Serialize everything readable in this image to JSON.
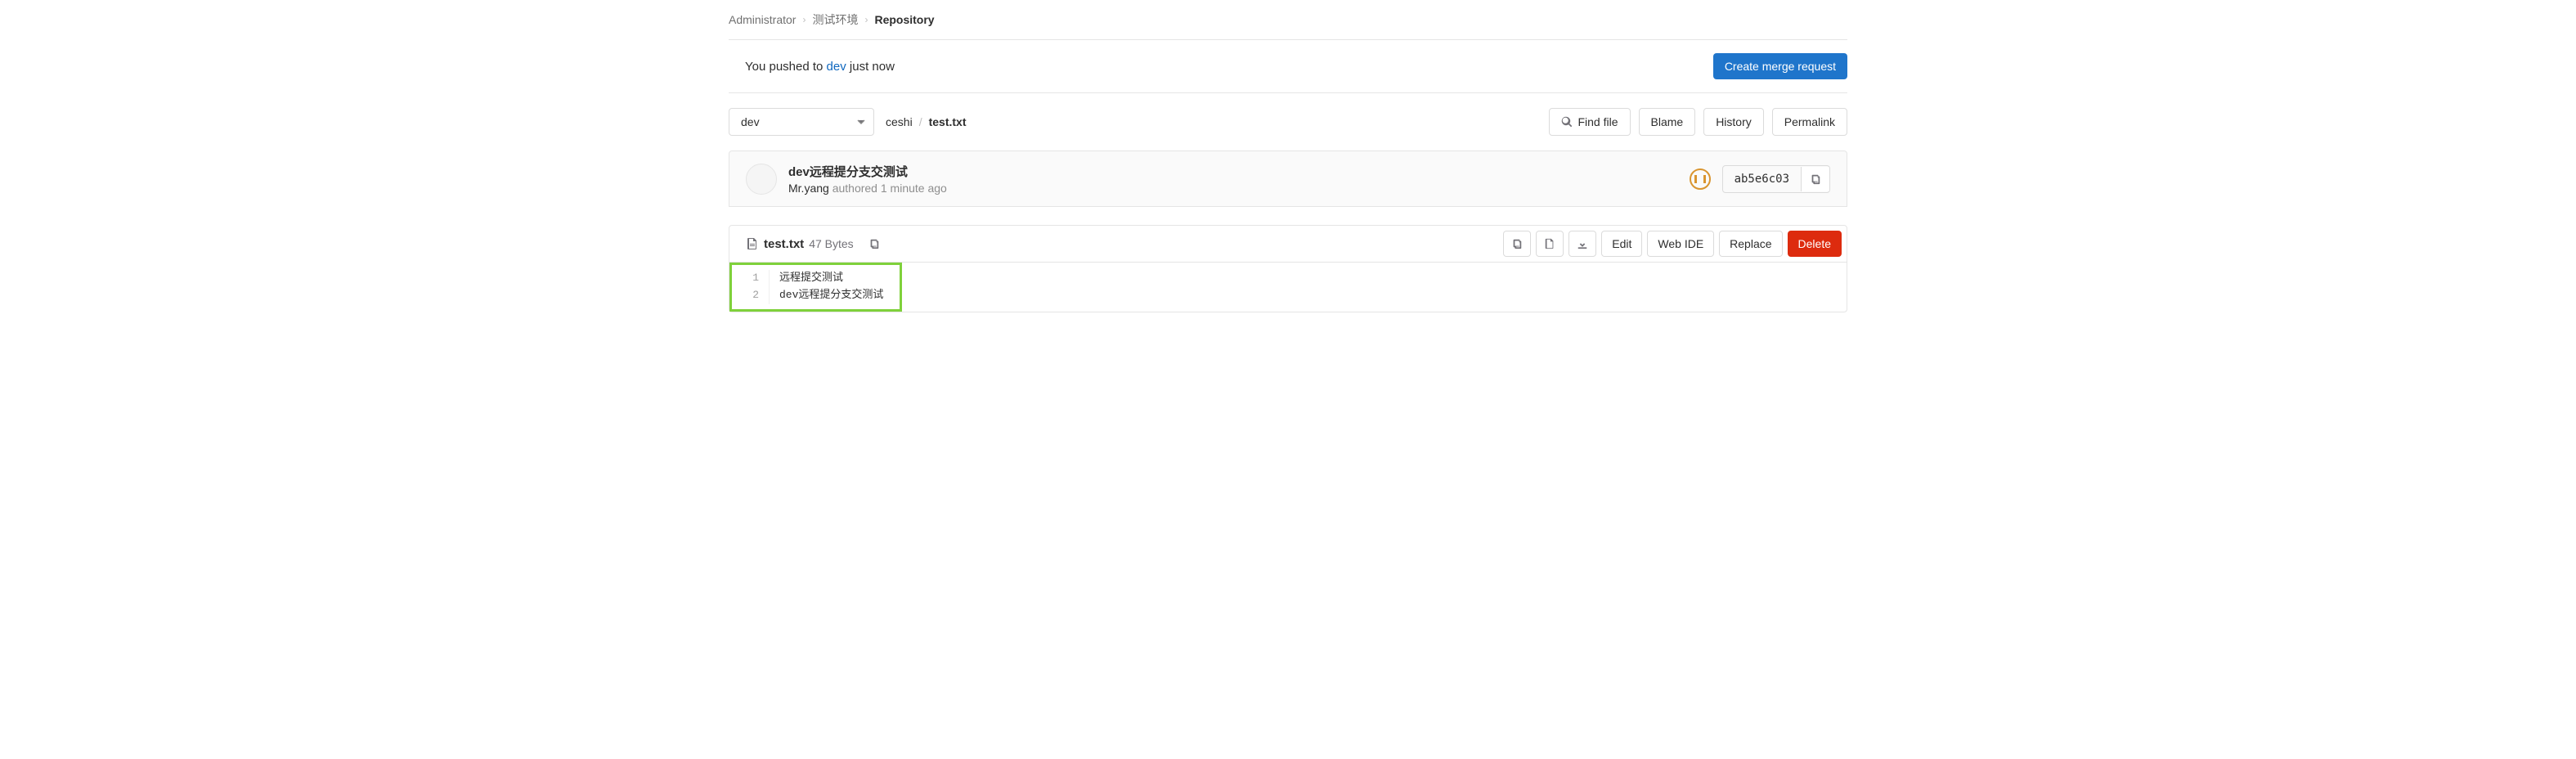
{
  "breadcrumb": {
    "items": [
      "Administrator",
      "测试环境",
      "Repository"
    ]
  },
  "push_banner": {
    "prefix": "You pushed to ",
    "branch": "dev",
    "suffix": " just now",
    "button": "Create merge request"
  },
  "branch_selector": {
    "value": "dev"
  },
  "file_path": {
    "parts": [
      "ceshi"
    ],
    "current": "test.txt"
  },
  "nav_buttons": {
    "find_file": "Find file",
    "blame": "Blame",
    "history": "History",
    "permalink": "Permalink"
  },
  "commit": {
    "title": "dev远程提分支交测试",
    "author": "Mr.yang",
    "authored": "authored",
    "time": "1 minute ago",
    "sha": "ab5e6c03"
  },
  "file_info": {
    "name": "test.txt",
    "size": "47 Bytes"
  },
  "file_actions": {
    "edit": "Edit",
    "web_ide": "Web IDE",
    "replace": "Replace",
    "delete": "Delete"
  },
  "code_lines": [
    {
      "num": "1",
      "content": "远程提交测试"
    },
    {
      "num": "2",
      "content": "dev远程提分支交测试"
    }
  ]
}
